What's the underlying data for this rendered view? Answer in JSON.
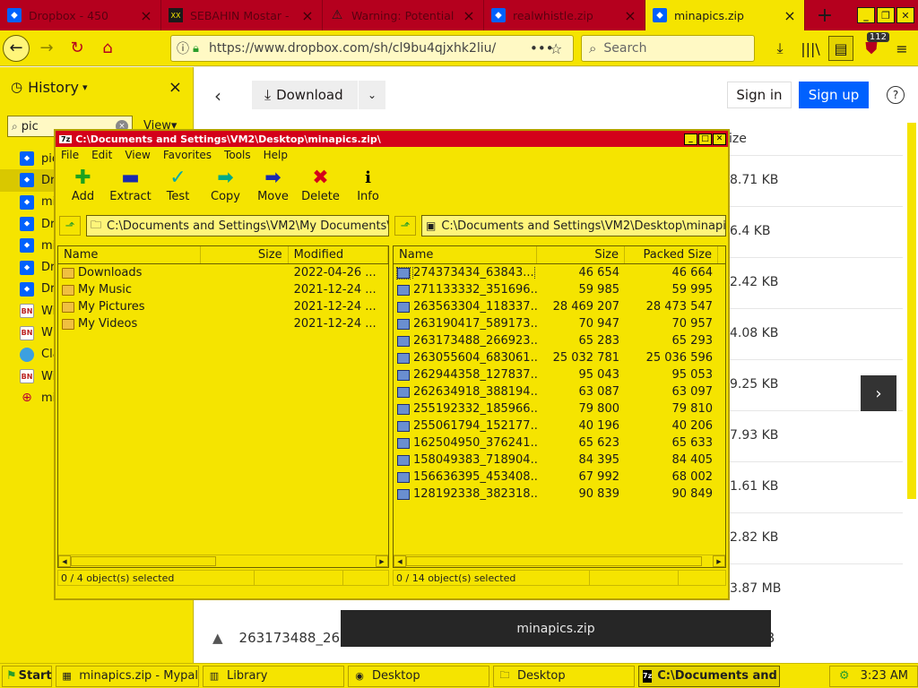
{
  "browser": {
    "tabs": [
      {
        "title": "Dropbox - 450",
        "icon": "dropbox-icon"
      },
      {
        "title": "SEBAHIN Mostar -",
        "icon": "site-icon"
      },
      {
        "title": "Warning: Potential",
        "icon": "warning-icon"
      },
      {
        "title": "realwhistle.zip",
        "icon": "dropbox-icon"
      },
      {
        "title": "minapics.zip",
        "icon": "dropbox-icon"
      }
    ],
    "url": "https://www.dropbox.com/sh/cl9bu4qjxhk2liu/",
    "search_placeholder": "Search",
    "badge_count": "112"
  },
  "sidebar": {
    "title": "History",
    "search_value": "pic",
    "views_label": "View▾",
    "items": [
      {
        "label": "pic",
        "icon": "db"
      },
      {
        "label": "Dro",
        "icon": "db"
      },
      {
        "label": "min",
        "icon": "db"
      },
      {
        "label": "Dro",
        "icon": "db"
      },
      {
        "label": "min",
        "icon": "db"
      },
      {
        "label": "Dro",
        "icon": "db"
      },
      {
        "label": "Dro",
        "icon": "db"
      },
      {
        "label": "Wi",
        "icon": "bn"
      },
      {
        "label": "Wh",
        "icon": "bn"
      },
      {
        "label": "Cla",
        "icon": "gl"
      },
      {
        "label": "Wi",
        "icon": "bn"
      },
      {
        "label": "mi",
        "icon": "wb"
      }
    ]
  },
  "dropbox": {
    "download_label": "Download",
    "signin_label": "Sign in",
    "signup_label": "Sign up",
    "size_header": "ize",
    "sizes": [
      "8.71 KB",
      "6.4 KB",
      "2.42 KB",
      "4.08 KB",
      "9.25 KB",
      "7.93 KB",
      "1.61 KB",
      "2.82 KB",
      "3.87 MB"
    ],
    "bottom_row_name": "263173488_26",
    "bottom_row_size": "B",
    "tooltip": "minapics.zip"
  },
  "sevenzip": {
    "title": "C:\\Documents and Settings\\VM2\\Desktop\\minapics.zip\\",
    "menu": [
      "File",
      "Edit",
      "View",
      "Favorites",
      "Tools",
      "Help"
    ],
    "tools": [
      "Add",
      "Extract",
      "Test",
      "Copy",
      "Move",
      "Delete",
      "Info"
    ],
    "left": {
      "path": "C:\\Documents and Settings\\VM2\\My Documents\\",
      "columns": [
        "Name",
        "Size",
        "Modified"
      ],
      "rows": [
        {
          "name": "Downloads",
          "size": "",
          "modified": "2022-04-26 ..."
        },
        {
          "name": "My Music",
          "size": "",
          "modified": "2021-12-24 ..."
        },
        {
          "name": "My Pictures",
          "size": "",
          "modified": "2021-12-24 ..."
        },
        {
          "name": "My Videos",
          "size": "",
          "modified": "2021-12-24 ..."
        }
      ],
      "status": "0 / 4 object(s) selected"
    },
    "right": {
      "path": "C:\\Documents and Settings\\VM2\\Desktop\\minapic",
      "columns": [
        "Name",
        "Size",
        "Packed Size"
      ],
      "rows": [
        {
          "name": "274373434_63843...",
          "size": "46 654",
          "packed": "46 664"
        },
        {
          "name": "271133332_351696...",
          "size": "59 985",
          "packed": "59 995"
        },
        {
          "name": "263563304_118337...",
          "size": "28 469 207",
          "packed": "28 473 547"
        },
        {
          "name": "263190417_589173...",
          "size": "70 947",
          "packed": "70 957"
        },
        {
          "name": "263173488_266923...",
          "size": "65 283",
          "packed": "65 293"
        },
        {
          "name": "263055604_683061...",
          "size": "25 032 781",
          "packed": "25 036 596"
        },
        {
          "name": "262944358_127837...",
          "size": "95 043",
          "packed": "95 053"
        },
        {
          "name": "262634918_388194...",
          "size": "63 087",
          "packed": "63 097"
        },
        {
          "name": "255192332_185966...",
          "size": "79 800",
          "packed": "79 810"
        },
        {
          "name": "255061794_152177...",
          "size": "40 196",
          "packed": "40 206"
        },
        {
          "name": "162504950_376241...",
          "size": "65 623",
          "packed": "65 633"
        },
        {
          "name": "158049383_718904...",
          "size": "84 395",
          "packed": "84 405"
        },
        {
          "name": "156636395_453408...",
          "size": "67 992",
          "packed": "68 002"
        },
        {
          "name": "128192338_382318...",
          "size": "90 839",
          "packed": "90 849"
        }
      ],
      "status": "0 / 14 object(s) selected"
    }
  },
  "taskbar": {
    "start_label": "Start",
    "items": [
      {
        "label": "minapics.zip - Mypal",
        "icon": "browser-icon"
      },
      {
        "label": "Library",
        "icon": "library-icon"
      },
      {
        "label": "Desktop",
        "icon": "explorer-icon"
      },
      {
        "label": "Desktop",
        "icon": "folder-icon"
      },
      {
        "label": "C:\\Documents and ...",
        "icon": "sevenzip-icon"
      }
    ],
    "clock": "3:23 AM"
  }
}
